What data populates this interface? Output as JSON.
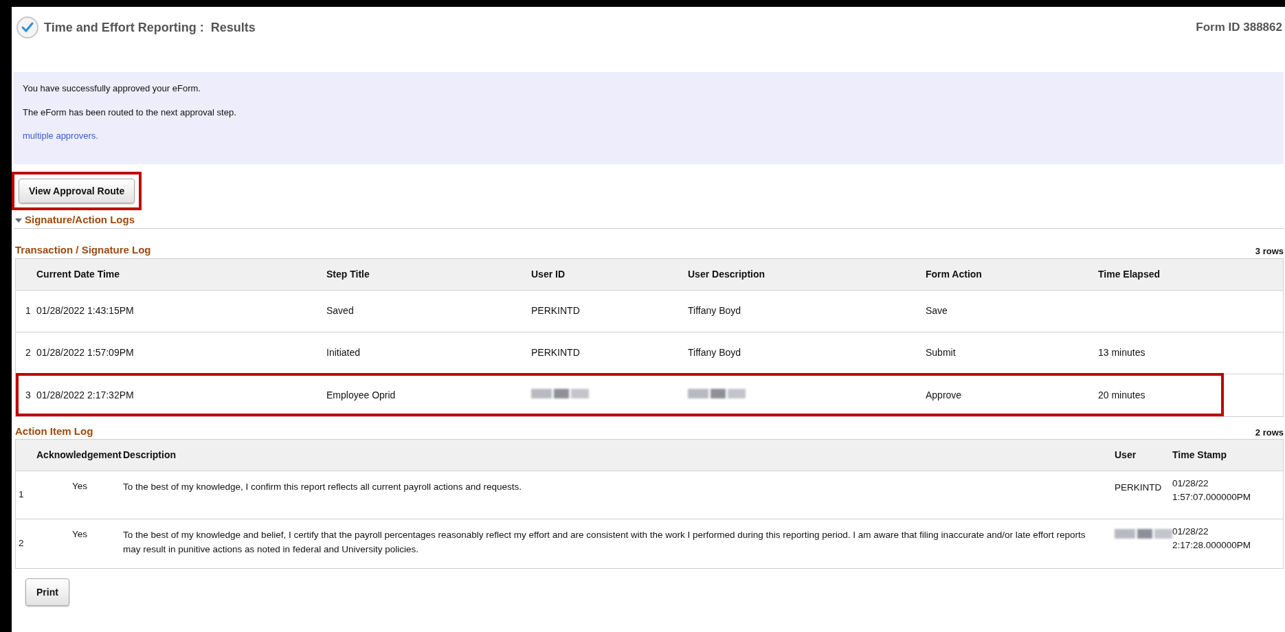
{
  "header": {
    "title": "Time and Effort Reporting :  Results",
    "form_id": "Form ID 388862"
  },
  "message": {
    "lines": [
      "You have successfully approved your eForm.",
      "The eForm has been routed to the next approval step."
    ],
    "link": "multiple approvers."
  },
  "route_button": {
    "label": "View Approval Route",
    "highlighted": true
  },
  "section": {
    "title": "Signature/Action Logs",
    "expanded": true
  },
  "transaction_log": {
    "title": "Transaction / Signature Log",
    "count": "3 rows",
    "columns": [
      "Current Date Time",
      "Step Title",
      "User ID",
      "User Description",
      "Form Action",
      "Time Elapsed"
    ],
    "rows": [
      {
        "number": "1",
        "date_time": "01/28/2022  1:43:15PM",
        "step_title": "Saved",
        "user_id": "PERKINTD",
        "user_id_redacted": false,
        "user_description": "Tiffany Boyd",
        "user_description_redacted": false,
        "form_action": "Save",
        "time_elapsed": "",
        "highlighted": false
      },
      {
        "number": "2",
        "date_time": "01/28/2022  1:57:09PM",
        "step_title": "Initiated",
        "user_id": "PERKINTD",
        "user_id_redacted": false,
        "user_description": "Tiffany Boyd",
        "user_description_redacted": false,
        "form_action": "Submit",
        "time_elapsed": "13 minutes",
        "highlighted": false
      },
      {
        "number": "3",
        "date_time": "01/28/2022  2:17:32PM",
        "step_title": "Employee Oprid",
        "user_id_redacted": true,
        "user_description_redacted": true,
        "form_action": "Approve",
        "time_elapsed": "20 minutes",
        "highlighted": true
      }
    ]
  },
  "action_log": {
    "title": "Action Item Log",
    "count": "2 rows",
    "columns": [
      "Acknowledgement",
      "Description",
      "User",
      "Time Stamp"
    ],
    "rows": [
      {
        "number": "1",
        "acknowledgement": "Yes",
        "description": "To the best of my knowledge, I confirm this report reflects all current payroll actions and requests.",
        "user": "PERKINTD",
        "user_redacted": false,
        "time_stamp": [
          "01/28/22",
          "1:57:07.000000PM"
        ]
      },
      {
        "number": "2",
        "acknowledgement": "Yes",
        "description": "To the best of my knowledge and belief, I certify that the payroll percentages reasonably reflect my effort and are consistent with the work I performed during this reporting period.  I am aware that filing inaccurate and/or late effort reports may result in punitive actions as noted in federal and University policies.",
        "user_redacted": true,
        "time_stamp": [
          "01/28/22",
          "2:17:28.000000PM"
        ]
      }
    ]
  },
  "print_button": {
    "label": "Print"
  }
}
